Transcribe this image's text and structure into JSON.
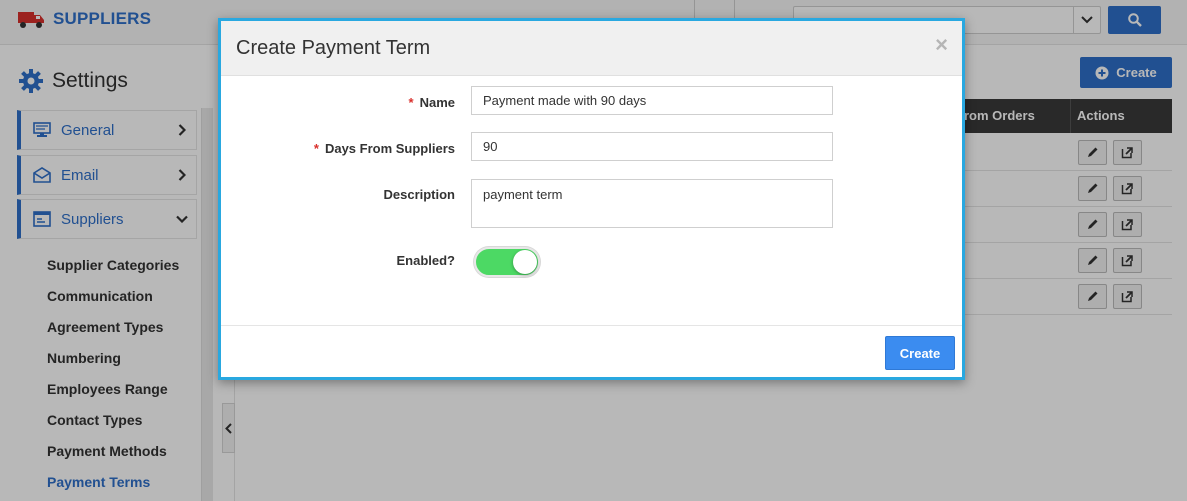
{
  "app": {
    "brand": "SUPPLIERS",
    "settings_title": "Settings"
  },
  "colors": {
    "accent": "#2f6fc9",
    "modal_border": "#29a8e0",
    "toggle_on": "#4cd964",
    "primary_button": "#3b8cf0",
    "required": "#d9302c"
  },
  "sidebar": {
    "items": [
      {
        "label": "General",
        "icon": "monitor-icon"
      },
      {
        "label": "Email",
        "icon": "envelope-icon"
      },
      {
        "label": "Suppliers",
        "icon": "window-icon"
      }
    ],
    "sub_items": [
      {
        "label": "Supplier Categories"
      },
      {
        "label": "Communication"
      },
      {
        "label": "Agreement Types"
      },
      {
        "label": "Numbering"
      },
      {
        "label": "Employees Range"
      },
      {
        "label": "Contact Types"
      },
      {
        "label": "Payment Methods"
      },
      {
        "label": "Payment Terms"
      }
    ]
  },
  "main": {
    "create_label": "Create",
    "table_headers": [
      "rom Orders",
      "Actions"
    ],
    "row_count": 5
  },
  "modal": {
    "title": "Create Payment Term",
    "close_symbol": "×",
    "fields": {
      "name_label": "Name",
      "name_value": "Payment made with 90 days",
      "days_label": "Days From Suppliers",
      "days_value": "90",
      "description_label": "Description",
      "description_value": "payment term",
      "enabled_label": "Enabled?",
      "enabled": true
    },
    "required_mark": "*",
    "create_button": "Create"
  }
}
